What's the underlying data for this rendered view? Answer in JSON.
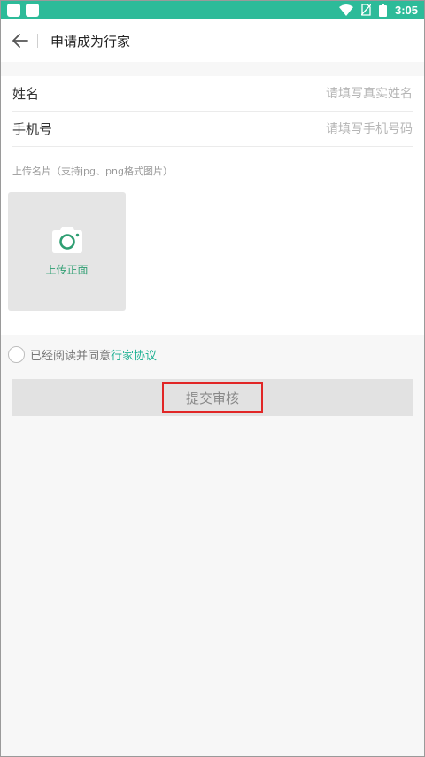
{
  "status_bar": {
    "time": "3:05",
    "icons": [
      "app-square-icon",
      "app-square-icon",
      "wifi-icon",
      "no-sim-icon",
      "battery-icon"
    ]
  },
  "header": {
    "title": "申请成为行家",
    "back_icon": "back-arrow-icon"
  },
  "form": {
    "name": {
      "label": "姓名",
      "placeholder": "请填写真实姓名",
      "value": ""
    },
    "phone": {
      "label": "手机号",
      "placeholder": "请填写手机号码",
      "value": ""
    },
    "upload_hint": "上传名片（支持jpg、png格式图片）",
    "upload": {
      "label": "上传正面",
      "icon": "camera-icon"
    }
  },
  "agreement": {
    "text": "已经阅读并同意",
    "link": "行家协议",
    "checked": false
  },
  "submit": {
    "label": "提交审核"
  },
  "colors": {
    "status_bar": "#2dbb99",
    "accent": "#21b294",
    "camera": "#2e9e72",
    "highlight": "#e12626"
  }
}
